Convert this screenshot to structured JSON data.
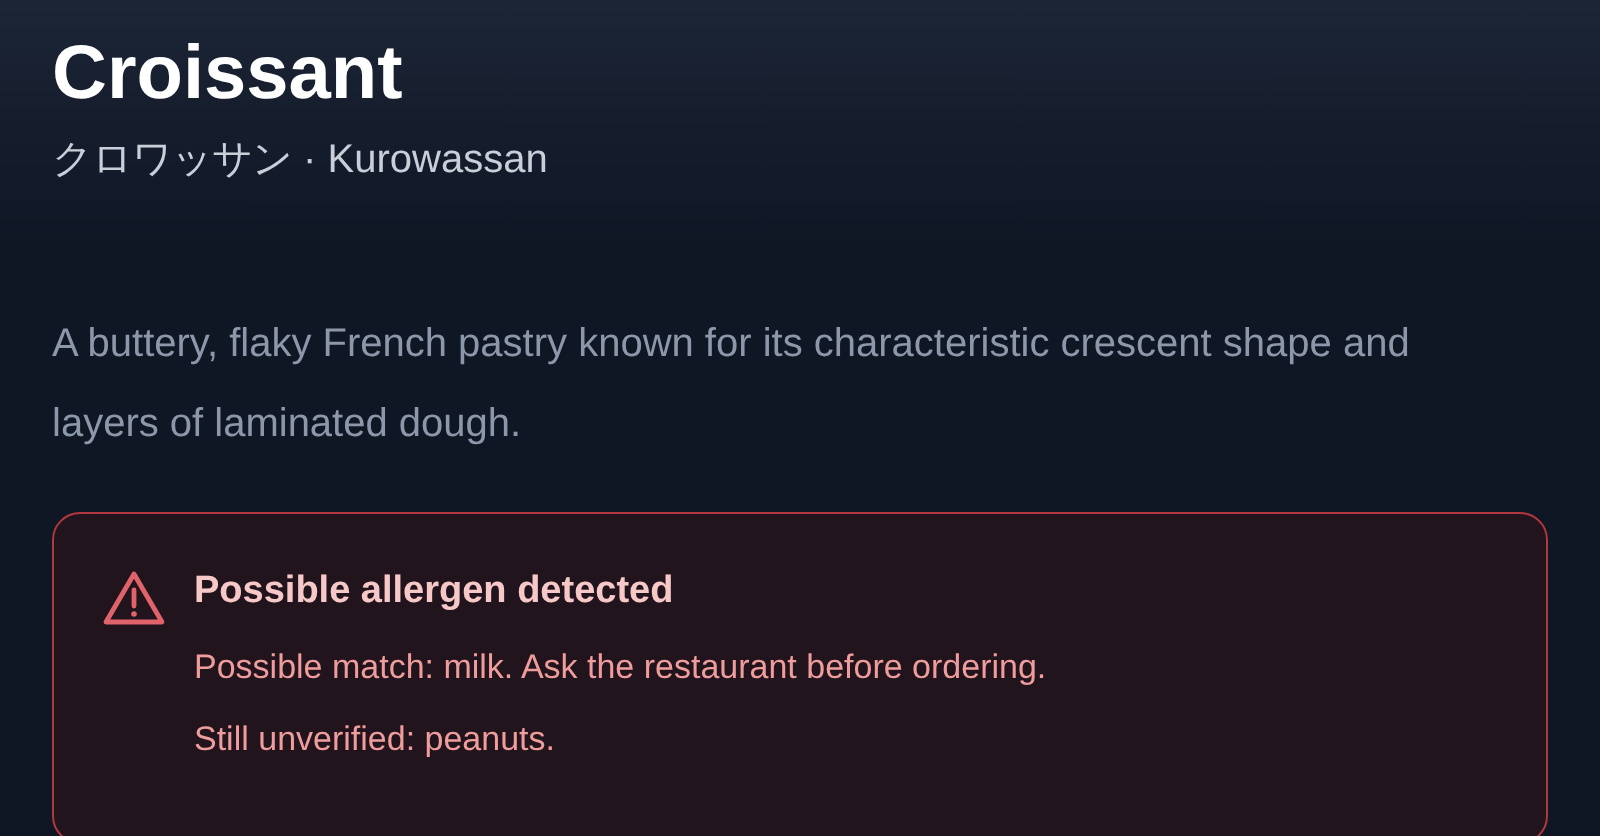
{
  "header": {
    "title": "Croissant",
    "subtitle": "クロワッサン · Kurowassan"
  },
  "description": "A buttery, flaky French pastry known for its characteristic crescent shape and layers of laminated dough.",
  "alert": {
    "kind": "warning",
    "title": "Possible allergen detected",
    "lines": [
      "Possible match: milk. Ask the restaurant before ordering.",
      "Still unverified: peanuts."
    ]
  }
}
